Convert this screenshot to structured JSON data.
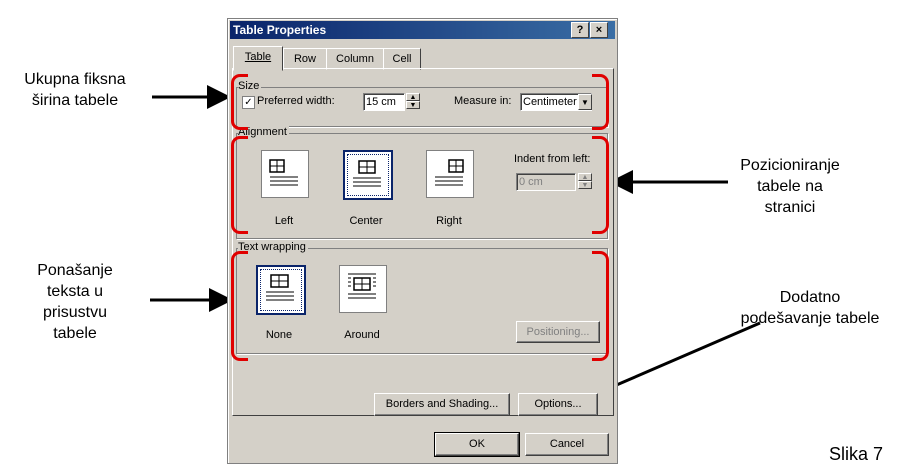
{
  "dialog": {
    "title": "Table Properties",
    "help_label": "?",
    "close_label": "×",
    "tabs": [
      "Table",
      "Row",
      "Column",
      "Cell"
    ],
    "size": {
      "group_label": "Size",
      "preferred_width_label": "Preferred width:",
      "preferred_width_checked": true,
      "preferred_width_value": "15 cm",
      "measure_in_label": "Measure in:",
      "measure_in_value": "Centimeter"
    },
    "alignment": {
      "group_label": "Alignment",
      "options": [
        "Left",
        "Center",
        "Right"
      ],
      "selected": "Center",
      "indent_label": "Indent from left:",
      "indent_value": "0 cm"
    },
    "text_wrapping": {
      "group_label": "Text wrapping",
      "options": [
        "None",
        "Around"
      ],
      "selected": "None",
      "positioning_label": "Positioning..."
    },
    "borders_label": "Borders and Shading...",
    "options_label": "Options...",
    "ok_label": "OK",
    "cancel_label": "Cancel"
  },
  "annotations": {
    "size": "Ukupna fiksna\nširina tabele",
    "alignment": "Pozicioniranje\ntabele na\nstranici",
    "wrapping": "Ponašanje\nteksta u\nprisustvu\ntabele",
    "options": "Dodatno\npodešavanje tabele"
  },
  "caption": "Slika 7",
  "colors": {
    "annotation_bracket": "#e00000",
    "titlebar": "#0a246a",
    "dialog_face": "#d4d0c8"
  }
}
